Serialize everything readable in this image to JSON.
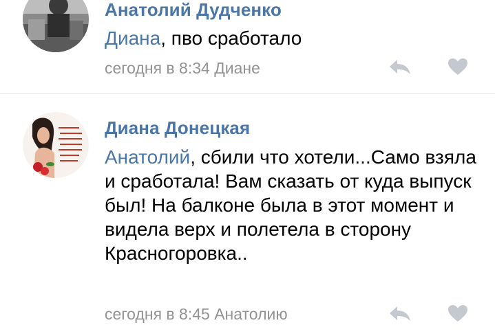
{
  "comments": [
    {
      "author": "Анатолий Дудченко",
      "mention": "Диана",
      "text": ", пво сработало",
      "time": "сегодня в 8:34",
      "reply_to": "Диане"
    },
    {
      "author": "Диана Донецкая",
      "mention": "Анатолий",
      "text": ", сбили что хотели...Само взяла и сработала! Вам сказать от куда выпуск был! На балконе была в этот момент и видела верх и полетела в сторону Красногоровка..",
      "time": "сегодня в 8:45",
      "reply_to": "Анатолию"
    }
  ],
  "icons": {
    "reply": "reply-arrow-icon",
    "like": "heart-icon"
  },
  "colors": {
    "link": "#4a76a8",
    "meta": "#939393",
    "icon": "#c4c8cf"
  }
}
